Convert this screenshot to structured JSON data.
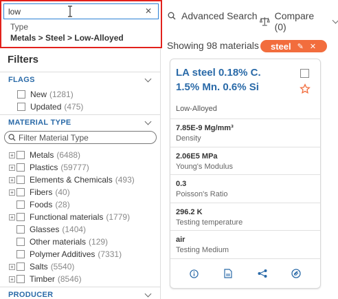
{
  "search": {
    "value": "low",
    "suggestion_type": "Type",
    "suggestion_path": "Metals > Steel > Low-Alloyed"
  },
  "toolbar": {
    "advanced_search": "Advanced Search",
    "compare": "Compare (0)"
  },
  "results": {
    "showing": "Showing 98 materials",
    "chip_label": "steel"
  },
  "sidebar": {
    "title": "Filters",
    "flags": {
      "heading": "FLAGS",
      "items": [
        {
          "label": "New",
          "count": "(1281)"
        },
        {
          "label": "Updated",
          "count": "(475)"
        }
      ]
    },
    "material_type": {
      "heading": "MATERIAL TYPE",
      "filter_placeholder": "Filter Material Type",
      "items": [
        {
          "label": "Metals",
          "count": "(6488)",
          "expandable": true
        },
        {
          "label": "Plastics",
          "count": "(59777)",
          "expandable": true
        },
        {
          "label": "Elements & Chemicals",
          "count": "(493)",
          "expandable": true
        },
        {
          "label": "Fibers",
          "count": "(40)",
          "expandable": true
        },
        {
          "label": "Foods",
          "count": "(28)",
          "expandable": false
        },
        {
          "label": "Functional materials",
          "count": "(1779)",
          "expandable": true
        },
        {
          "label": "Glasses",
          "count": "(1404)",
          "expandable": false
        },
        {
          "label": "Other materials",
          "count": "(129)",
          "expandable": false
        },
        {
          "label": "Polymer Additives",
          "count": "(7331)",
          "expandable": false
        },
        {
          "label": "Salts",
          "count": "(5540)",
          "expandable": true
        },
        {
          "label": "Timber",
          "count": "(8546)",
          "expandable": true
        }
      ]
    },
    "producer": {
      "heading": "PRODUCER"
    }
  },
  "card": {
    "title_line1": "LA steel 0.18% C.",
    "title_line2": "1.5% Mn. 0.6% Si",
    "category": "Low-Alloyed",
    "properties": [
      {
        "value": "7.85E-9 Mg/mm³",
        "name": "Density"
      },
      {
        "value": "2.06E5 MPa",
        "name": "Young's Modulus"
      },
      {
        "value": "0.3",
        "name": "Poisson's Ratio"
      },
      {
        "value": "296.2 K",
        "name": "Testing temperature"
      },
      {
        "value": "air",
        "name": "Testing Medium"
      }
    ]
  },
  "colors": {
    "accent_blue": "#2a6aa8",
    "chip_orange": "#f26d3d",
    "highlight_red": "#e2211c"
  }
}
